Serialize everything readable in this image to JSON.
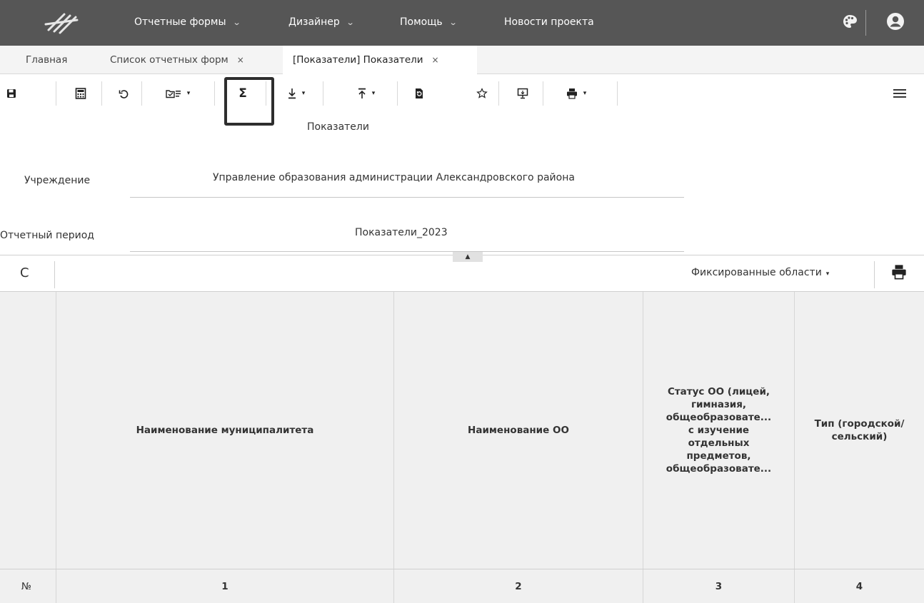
{
  "navbar": {
    "logo_icon": "logo-icon",
    "menus": [
      {
        "label": "Отчетные формы",
        "has_dropdown": true
      },
      {
        "label": "Дизайнер",
        "has_dropdown": true
      },
      {
        "label": "Помощь",
        "has_dropdown": true
      },
      {
        "label": "Новости проекта",
        "has_dropdown": false
      }
    ],
    "chevron_glyph": "⌄",
    "right_icons": [
      "palette-icon",
      "user-account-icon"
    ]
  },
  "tabs": [
    {
      "label": "Главная",
      "closable": false,
      "active": false
    },
    {
      "label": "Список отчетных форм",
      "closable": true,
      "active": false
    },
    {
      "label": "[Показатели] Показатели",
      "closable": true,
      "active": true
    }
  ],
  "tab_close_glyph": "×",
  "toolbar": {
    "buttons": [
      "save-icon",
      "calculator-icon",
      "undo-icon",
      "import-export-icon",
      "sum-icon",
      "download-icon",
      "upload-icon",
      "refresh-document-icon",
      "favorite-star-icon",
      "presentation-icon",
      "print-icon",
      "menu-icon"
    ],
    "sigma_glyph": "Σ",
    "caret_glyph": "▾",
    "highlighted": "sum-icon"
  },
  "form": {
    "title": "Показатели",
    "fields": [
      {
        "label": "Учреждение",
        "value": "Управление образования администрации Александровского района"
      },
      {
        "label": "Отчетный период",
        "value": "Показатели_2023"
      }
    ]
  },
  "grid_toolbar": {
    "refresh_glyph": "C",
    "fixed_areas_label": "Фиксированные области",
    "caret_glyph": "▾",
    "collapse_glyph": "▲"
  },
  "table": {
    "columns": [
      {
        "header": "",
        "number": "№"
      },
      {
        "header": "Наименование муниципалитета",
        "number": "1"
      },
      {
        "header": "Наименование ОО",
        "number": "2"
      },
      {
        "header": "Статус ОО (лицей,\nгимназия,\nобщеобразовате...\nс изучение\nотдельных\nпредметов,\nобщеобразовате...",
        "number": "3"
      },
      {
        "header": "Тип (городской/\nсельский)",
        "number": "4"
      }
    ]
  }
}
